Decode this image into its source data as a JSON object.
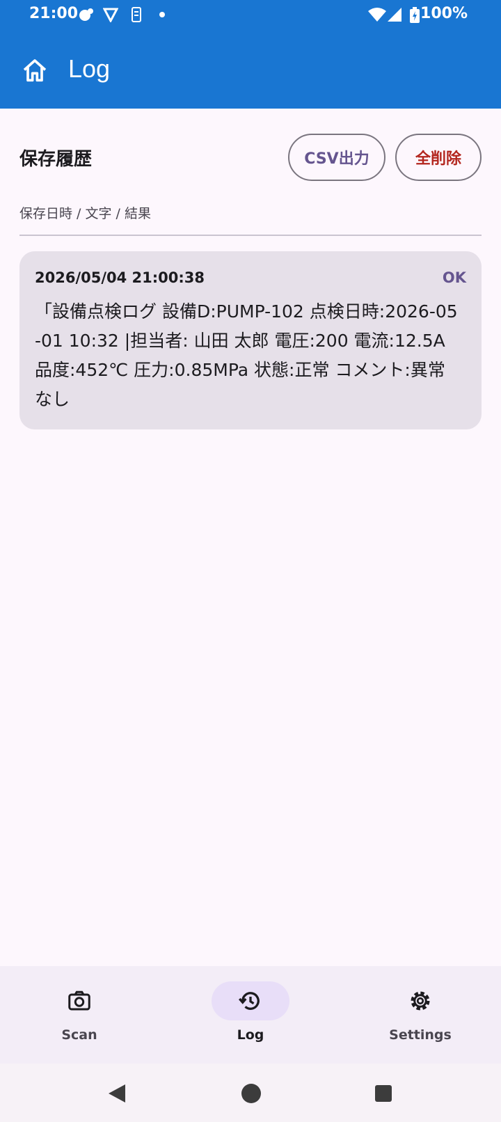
{
  "status_bar": {
    "time": "21:00",
    "battery": "100%"
  },
  "app_bar": {
    "title": "Log",
    "home_icon": "home-icon"
  },
  "history": {
    "title": "保存履歴",
    "csv_button": "CSV出力",
    "delete_all_button": "全削除",
    "columns": "保存日時 / 文字 / 結果"
  },
  "entries": [
    {
      "date": "2026/05/04 21:00:38",
      "status": "OK",
      "text": "「設備点検ログ 設備D:PUMP-102 点検日時:2026-05-01 10:32 |担当者: 山田 太郎 電圧:200 電流:12.5A 品度:452℃ 圧力:0.85MPa 状態:正常 コメント:異常なし"
    }
  ],
  "bottom_nav": [
    {
      "label": "Scan",
      "icon": "camera-icon",
      "active": false
    },
    {
      "label": "Log",
      "icon": "history-icon",
      "active": true
    },
    {
      "label": "Settings",
      "icon": "gear-icon",
      "active": false
    }
  ],
  "colors": {
    "app_bar": "#1976D2",
    "background": "#FDF7FD",
    "card": "#E6E0E9",
    "accent": "#65558F",
    "danger": "#B3261E",
    "nav_bg": "#F3EDF7",
    "nav_active": "#E8DEF8"
  }
}
